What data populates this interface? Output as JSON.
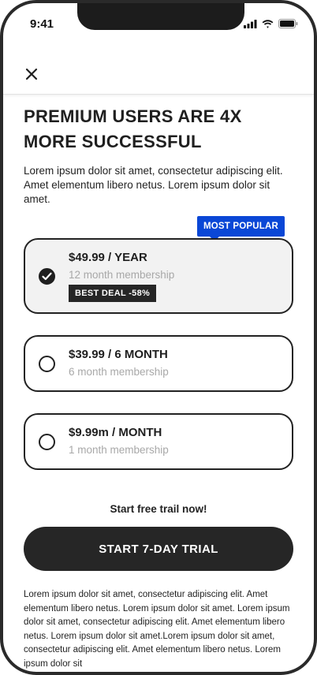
{
  "status_bar": {
    "time": "9:41"
  },
  "header": {
    "close_icon": "close-icon"
  },
  "content": {
    "title": "PREMIUM USERS ARE 4X MORE SUCCESSFUL",
    "description": "Lorem ipsum dolor sit amet, consectetur adipiscing elit. Amet elementum libero netus. Lorem ipsum dolor sit amet."
  },
  "popular_badge": "MOST POPULAR",
  "plans": [
    {
      "price": "$49.99 / YEAR",
      "subtitle": "12 month membership",
      "badge": "BEST DEAL -58%",
      "selected": true
    },
    {
      "price": "$39.99 / 6 MONTH",
      "subtitle": "6 month membership",
      "selected": false
    },
    {
      "price": "$9.99m / MONTH",
      "subtitle": "1 month membership",
      "selected": false
    }
  ],
  "trail_prompt": "Start free trail now!",
  "cta_label": "START 7-DAY TRIAL",
  "footer_text": "Lorem ipsum dolor sit amet, consectetur adipiscing elit. Amet elementum libero netus. Lorem ipsum dolor sit amet. Lorem ipsum dolor sit amet, consectetur adipiscing elit. Amet elementum libero netus. Lorem ipsum dolor sit amet.Lorem ipsum dolor sit amet, consectetur adipiscing elit. Amet elementum libero netus. Lorem ipsum dolor sit",
  "colors": {
    "accent": "#0a47d6",
    "dark": "#262626",
    "muted": "#a8a8a8"
  }
}
